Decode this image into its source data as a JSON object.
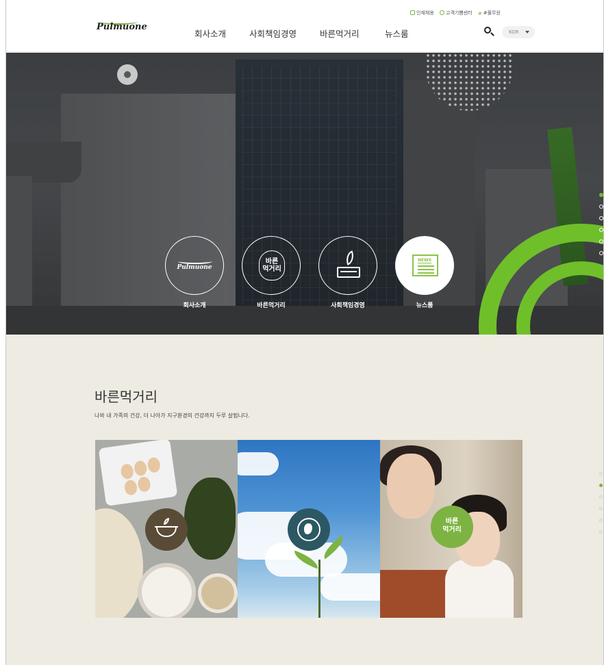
{
  "brand": {
    "logo_text": "Pulmuone",
    "accent": "#7cb342"
  },
  "header": {
    "nav": [
      "회사소개",
      "사회책임경영",
      "바른먹거리",
      "뉴스룸"
    ],
    "util": [
      "인재채용",
      "고객기쁨센터",
      "#풀무원"
    ],
    "lang": "KOR",
    "search_icon": "search-icon"
  },
  "hero": {
    "shortcuts": [
      {
        "label": "회사소개",
        "icon": "pulmuone-logo-icon",
        "logo_text": "Pulmuone"
      },
      {
        "label": "바른먹거리",
        "icon": "bareun-food-badge-icon",
        "badge_text": "바른\n먹거리"
      },
      {
        "label": "사회책임경영",
        "icon": "book-sprout-icon"
      },
      {
        "label": "뉴스룸",
        "icon": "newspaper-icon",
        "badge_text": "NEWS"
      }
    ],
    "pager_count": 6,
    "pager_active": 0
  },
  "section": {
    "title": "바른먹거리",
    "subtitle": "나와 내 가족의 건강, 더 나아가 지구환경의 건강까지 두루 살핍니다.",
    "cards": [
      {
        "name": "food-card",
        "icon": "bowl-sprout-icon"
      },
      {
        "name": "earth-card",
        "icon": "globe-leaf-icon"
      },
      {
        "name": "family-card",
        "icon": "bareun-food-badge-icon",
        "badge_text": "바른\n먹거리"
      }
    ],
    "pager_count": 6,
    "pager_active": 1
  }
}
